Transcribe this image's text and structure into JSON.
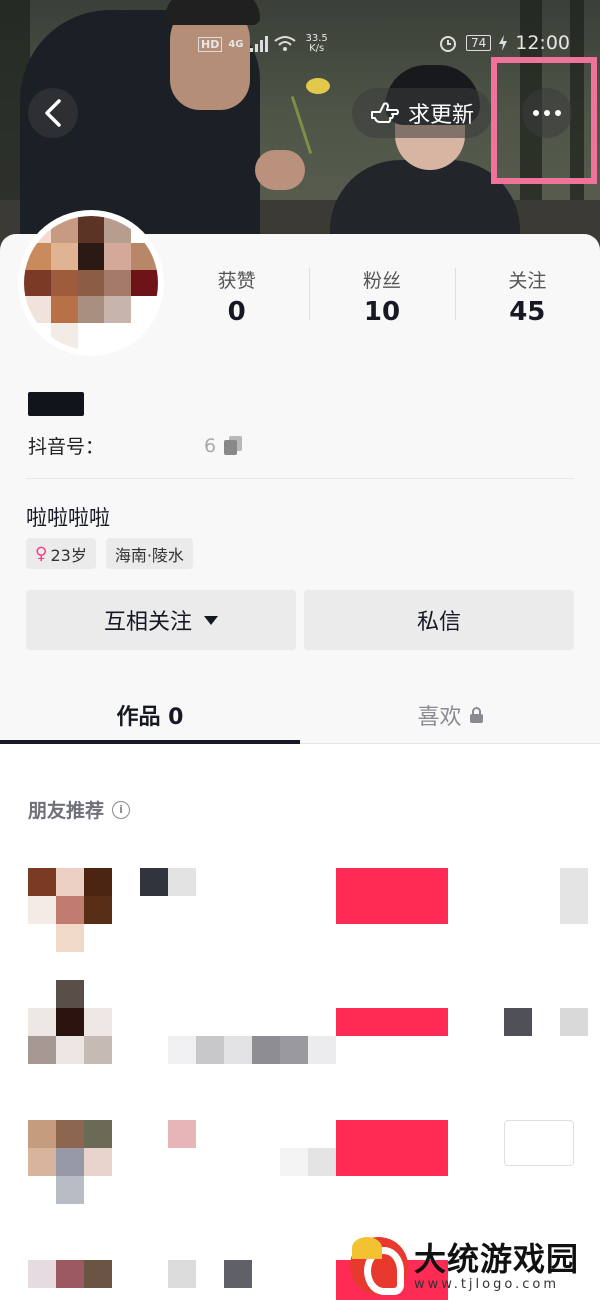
{
  "status_bar": {
    "hd": "HD",
    "network": "4G",
    "speed_value": "33.5",
    "speed_unit": "K/s",
    "battery": "74",
    "time": "12:00"
  },
  "header": {
    "urge_update_label": "求更新"
  },
  "profile": {
    "stats": [
      {
        "label": "获赞",
        "value": "0"
      },
      {
        "label": "粉丝",
        "value": "10"
      },
      {
        "label": "关注",
        "value": "45"
      }
    ],
    "douyin_id_label": "抖音号：",
    "douyin_id_tail": "6",
    "bio": "啦啦啦啦",
    "tags": {
      "age": "23岁",
      "gender_symbol": "♀",
      "location": "海南·陵水"
    },
    "actions": {
      "mutual_follow": "互相关注",
      "message": "私信"
    }
  },
  "tabs": {
    "works": "作品 0",
    "likes": "喜欢"
  },
  "recommend": {
    "title": "朋友推荐",
    "info_symbol": "i"
  },
  "colors": {
    "accent": "#fe2c55",
    "text_primary": "#161823",
    "highlight_box": "#f0739b",
    "card_bg": "#f8f8f8"
  },
  "watermark": {
    "title": "大统游戏园",
    "url": "www.tjlogo.com"
  }
}
